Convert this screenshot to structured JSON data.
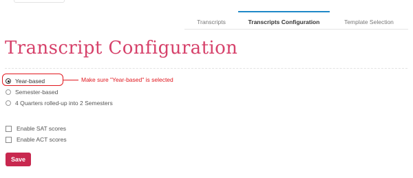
{
  "tabs": [
    {
      "label": "Transcripts",
      "active": false
    },
    {
      "label": "Transcripts Configuration",
      "active": true
    },
    {
      "label": "Template Selection",
      "active": false
    }
  ],
  "page_title": "Transcript Configuration",
  "transcript_type_options": [
    {
      "label": "Year-based",
      "selected": true
    },
    {
      "label": "Semester-based",
      "selected": false
    },
    {
      "label": "4 Quarters rolled-up into 2 Semesters",
      "selected": false
    }
  ],
  "score_options": [
    {
      "label": "Enable SAT scores",
      "checked": false
    },
    {
      "label": "Enable ACT scores",
      "checked": false
    }
  ],
  "annotation": {
    "text": "Make sure \"Year-based\" is selected",
    "color": "#e0161d"
  },
  "save_label": "Save",
  "colors": {
    "accent_pink": "#d6416a",
    "save_button": "#c8284f",
    "active_tab_border": "#1e88c7"
  }
}
